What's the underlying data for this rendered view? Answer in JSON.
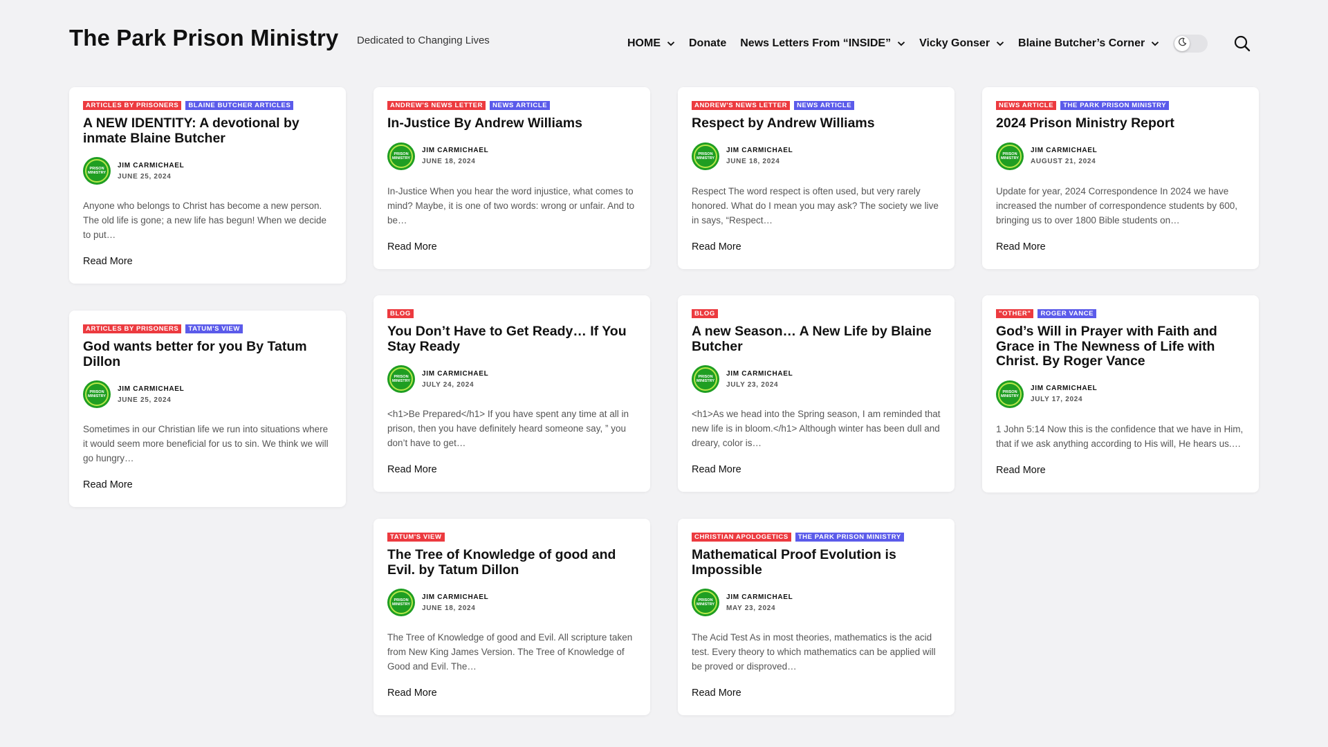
{
  "header": {
    "site_title": "The Park Prison Ministry",
    "tagline": "Dedicated to Changing Lives",
    "nav": [
      {
        "label": "HOME",
        "dropdown": true
      },
      {
        "label": "Donate",
        "dropdown": false
      },
      {
        "label": "News Letters From “INSIDE”",
        "dropdown": true
      },
      {
        "label": "Vicky Gonser",
        "dropdown": true
      },
      {
        "label": "Blaine Butcher’s Corner",
        "dropdown": true
      }
    ],
    "icons": {
      "toggle": "moon-icon",
      "search": "search-icon"
    }
  },
  "colors": {
    "category_red": "#ec3a3f",
    "category_blue": "#5b5bea",
    "avatar_green": "#1f9e22",
    "background": "#f2f2f4"
  },
  "read_more_label": "Read More",
  "avatar_text": "PRISON MINISTRY",
  "posts": [
    {
      "categories": [
        {
          "label": "ARTICLES BY PRISONERS",
          "color": "red"
        },
        {
          "label": "BLAINE BUTCHER ARTICLES",
          "color": "blue"
        }
      ],
      "title": "A NEW IDENTITY: A devotional by inmate Blaine Butcher",
      "author": "JIM CARMICHAEL",
      "date": "JUNE 25, 2024",
      "excerpt": "Anyone who belongs to Christ has become a new person. The old life is gone; a new life has begun! When we decide to put…"
    },
    {
      "categories": [
        {
          "label": "ANDREW'S NEWS LETTER",
          "color": "red"
        },
        {
          "label": "NEWS ARTICLE",
          "color": "blue"
        }
      ],
      "title": "In-Justice By Andrew Williams",
      "author": "JIM CARMICHAEL",
      "date": "JUNE 18, 2024",
      "excerpt": "In-Justice   When you hear the word injustice, what comes to mind? Maybe, it is one of two words: wrong or unfair. And to be…"
    },
    {
      "categories": [
        {
          "label": "ANDREW'S NEWS LETTER",
          "color": "red"
        },
        {
          "label": "NEWS ARTICLE",
          "color": "blue"
        }
      ],
      "title": "Respect by Andrew Williams",
      "author": "JIM CARMICHAEL",
      "date": "JUNE 18, 2024",
      "excerpt": "Respect The word respect is often used, but very rarely honored. What do I mean you may ask? The society we live in says, “Respect…"
    },
    {
      "categories": [
        {
          "label": "NEWS ARTICLE",
          "color": "red"
        },
        {
          "label": "THE PARK PRISON MINISTRY",
          "color": "blue"
        }
      ],
      "title": "2024 Prison Ministry Report",
      "author": "JIM CARMICHAEL",
      "date": "AUGUST 21, 2024",
      "excerpt": "Update for year, 2024 Correspondence In 2024 we have increased the number of correspondence students by 600, bringing us to over 1800 Bible students on…"
    },
    {
      "categories": [
        {
          "label": "ARTICLES BY PRISONERS",
          "color": "red"
        },
        {
          "label": "TATUM'S VIEW",
          "color": "blue"
        }
      ],
      "title": "God wants better for you By Tatum Dillon",
      "author": "JIM CARMICHAEL",
      "date": "JUNE 25, 2024",
      "excerpt": "Sometimes in our Christian life we run into situations where it would seem more beneficial for us to sin. We think we will go hungry…"
    },
    {
      "categories": [
        {
          "label": "BLOG",
          "color": "red"
        }
      ],
      "title": "You Don’t Have to Get Ready… If You Stay Ready",
      "author": "JIM CARMICHAEL",
      "date": "JULY 24, 2024",
      "excerpt": "<h1>Be Prepared</h1> If you have spent any time at all in prison, then you have definitely heard someone say, ” you don’t have to get…"
    },
    {
      "categories": [
        {
          "label": "BLOG",
          "color": "red"
        }
      ],
      "title": "A new Season… A New Life by Blaine Butcher",
      "author": "JIM CARMICHAEL",
      "date": "JULY 23, 2024",
      "excerpt": "<h1>As we head into the Spring season, I am reminded that new life is in bloom.</h1> Although winter has been dull and dreary, color is…"
    },
    {
      "categories": [
        {
          "label": "\"OTHER\"",
          "color": "red"
        },
        {
          "label": "ROGER VANCE",
          "color": "blue"
        }
      ],
      "title": "God’s Will in Prayer with Faith and Grace in The Newness of Life with Christ. By Roger Vance",
      "author": "JIM CARMICHAEL",
      "date": "JULY 17, 2024",
      "excerpt": "1 John 5:14 Now this is the confidence that we have in Him, that if we ask anything according to His will, He hears us.…"
    },
    {
      "categories": [
        {
          "label": "TATUM'S VIEW",
          "color": "red"
        }
      ],
      "title": "The Tree of Knowledge of good and Evil. by Tatum Dillon",
      "author": "JIM CARMICHAEL",
      "date": "JUNE 18, 2024",
      "excerpt": "The Tree of Knowledge of good and Evil.   All scripture taken from New King James Version.  The Tree of Knowledge of Good and Evil. The…"
    },
    {
      "categories": [
        {
          "label": "CHRISTIAN APOLOGETICS",
          "color": "red"
        },
        {
          "label": "THE PARK PRISON MINISTRY",
          "color": "blue"
        }
      ],
      "title": "Mathematical Proof Evolution is Impossible",
      "author": "JIM CARMICHAEL",
      "date": "MAY 23, 2024",
      "excerpt": "The Acid Test As in most theories, mathematics is the acid test. Every theory to which mathematics can be applied will be proved or disproved…"
    }
  ]
}
